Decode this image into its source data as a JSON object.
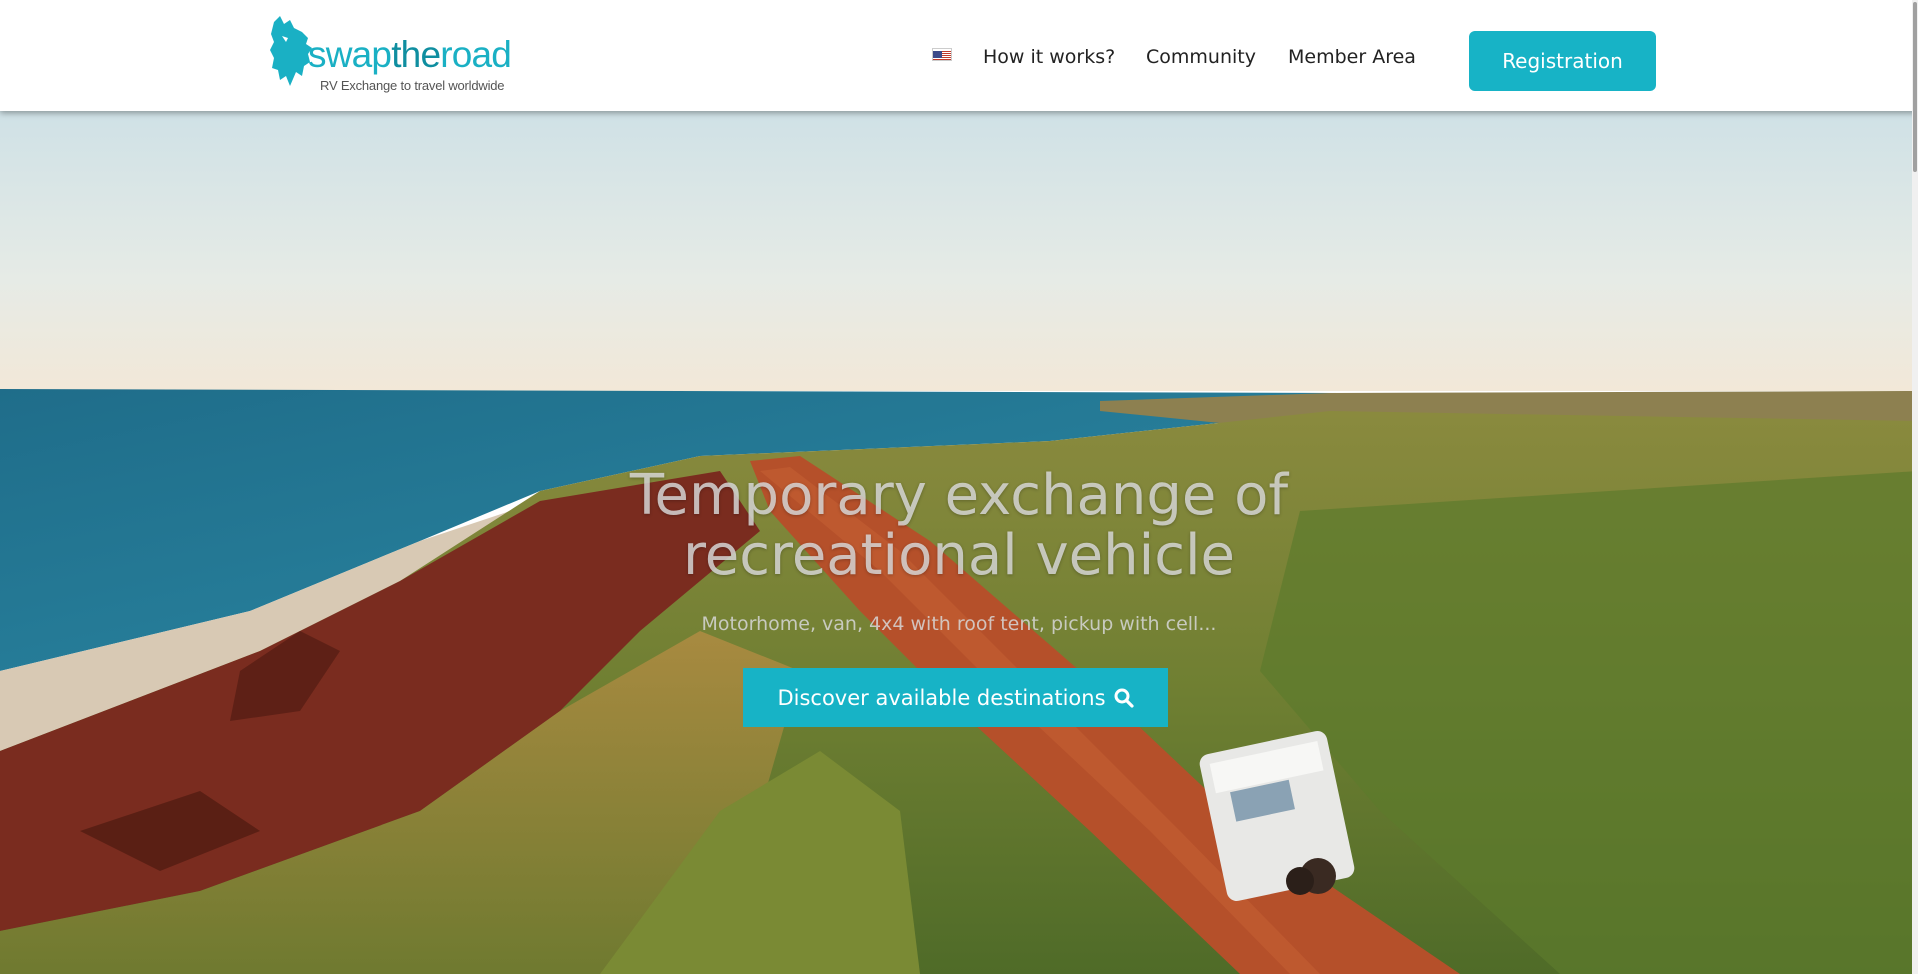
{
  "header": {
    "logo": {
      "word_a": "swap",
      "word_b": "the",
      "word_c": "road",
      "tagline": "RV Exchange to travel worldwide"
    },
    "language_icon": "us-flag-icon",
    "nav": [
      {
        "label": "How it works?"
      },
      {
        "label": "Community"
      },
      {
        "label": "Member Area"
      }
    ],
    "registration_label": "Registration"
  },
  "hero": {
    "title_line1": "Temporary exchange of",
    "title_line2": "recreational vehicle",
    "subtitle": "Motorhome, van, 4x4 with roof tent, pickup with cell...",
    "cta_label": "Discover available destinations",
    "cta_icon": "search-icon"
  },
  "colors": {
    "accent": "#17b3c6",
    "logo_teal": "#1ab0c4"
  }
}
